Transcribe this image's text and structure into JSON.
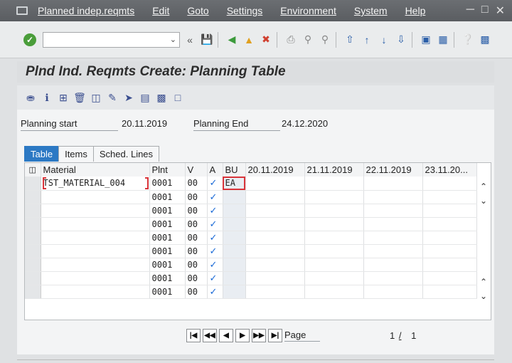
{
  "menu": [
    "Planned indep.reqmts",
    "Edit",
    "Goto",
    "Settings",
    "Environment",
    "System",
    "Help"
  ],
  "command_field": {
    "value": ""
  },
  "title": "Plnd Ind. Reqmts Create: Planning Table",
  "fields": {
    "planning_start_label": "Planning start",
    "planning_start_value": "20.11.2019",
    "planning_end_label": "Planning End",
    "planning_end_value": "24.12.2020"
  },
  "tabs": [
    "Table",
    "Items",
    "Sched. Lines"
  ],
  "table": {
    "headers": [
      "Material",
      "Plnt",
      "V",
      "A",
      "BU",
      "20.11.2019",
      "21.11.2019",
      "22.11.2019",
      "23.11.20..."
    ],
    "rows": [
      {
        "material": "TST_MATERIAL_004",
        "plant": "0001",
        "v": "00",
        "bu": "EA"
      },
      {
        "material": "",
        "plant": "0001",
        "v": "00",
        "bu": ""
      },
      {
        "material": "",
        "plant": "0001",
        "v": "00",
        "bu": ""
      },
      {
        "material": "",
        "plant": "0001",
        "v": "00",
        "bu": ""
      },
      {
        "material": "",
        "plant": "0001",
        "v": "00",
        "bu": ""
      },
      {
        "material": "",
        "plant": "0001",
        "v": "00",
        "bu": ""
      },
      {
        "material": "",
        "plant": "0001",
        "v": "00",
        "bu": ""
      },
      {
        "material": "",
        "plant": "0001",
        "v": "00",
        "bu": ""
      },
      {
        "material": "",
        "plant": "0001",
        "v": "00",
        "bu": ""
      }
    ]
  },
  "pager": {
    "label": "Page",
    "current": "1",
    "separator": "/",
    "total": "1"
  }
}
